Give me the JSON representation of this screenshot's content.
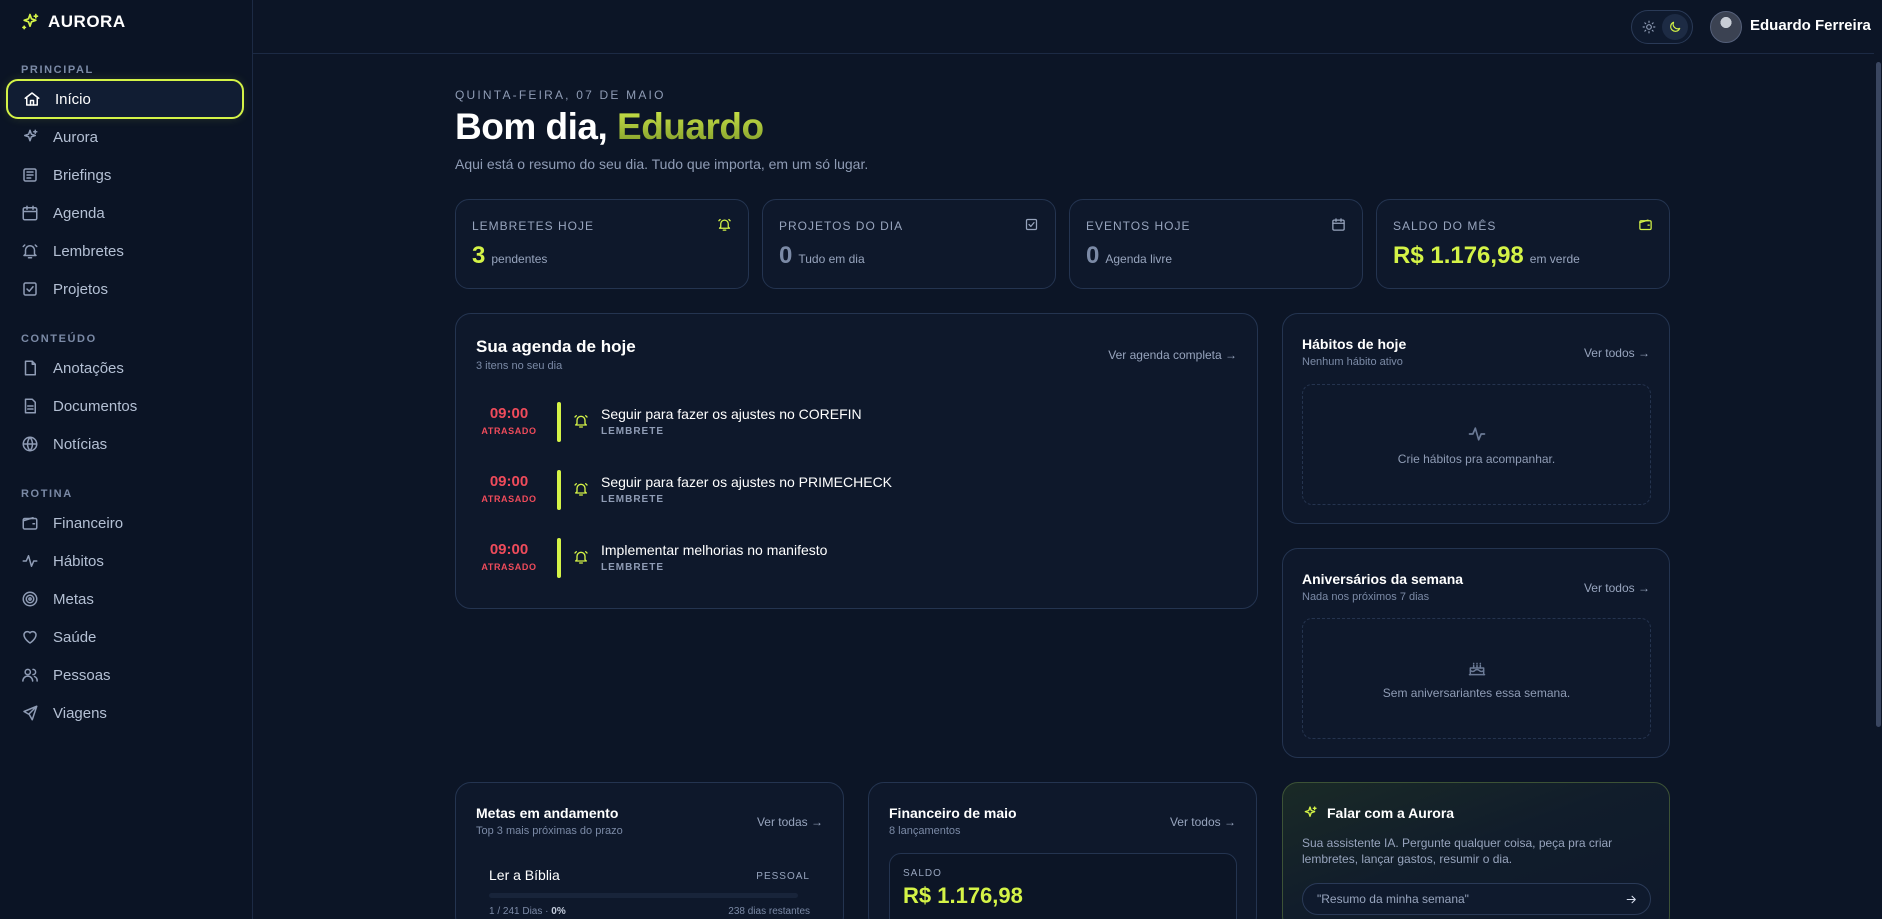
{
  "app": {
    "name": "AURORA"
  },
  "user": {
    "name": "Eduardo Ferreira"
  },
  "sidebar": {
    "sections": [
      {
        "label": "PRINCIPAL",
        "items": [
          {
            "label": "Início",
            "icon": "home-icon",
            "active": true
          },
          {
            "label": "Aurora",
            "icon": "sparkle-icon"
          },
          {
            "label": "Briefings",
            "icon": "newspaper-icon"
          },
          {
            "label": "Agenda",
            "icon": "calendar-icon"
          },
          {
            "label": "Lembretes",
            "icon": "bell-icon"
          },
          {
            "label": "Projetos",
            "icon": "checkbox-icon"
          }
        ]
      },
      {
        "label": "CONTEÚDO",
        "items": [
          {
            "label": "Anotações",
            "icon": "note-icon"
          },
          {
            "label": "Documentos",
            "icon": "document-icon"
          },
          {
            "label": "Notícias",
            "icon": "globe-icon"
          }
        ]
      },
      {
        "label": "ROTINA",
        "items": [
          {
            "label": "Financeiro",
            "icon": "wallet-icon"
          },
          {
            "label": "Hábitos",
            "icon": "activity-icon"
          },
          {
            "label": "Metas",
            "icon": "target-icon"
          },
          {
            "label": "Saúde",
            "icon": "heart-icon"
          },
          {
            "label": "Pessoas",
            "icon": "people-icon"
          },
          {
            "label": "Viagens",
            "icon": "plane-icon"
          }
        ]
      }
    ]
  },
  "header": {
    "date": "QUINTA-FEIRA, 07 DE MAIO",
    "greeting": "Bom dia,",
    "greeting_name": "Eduardo",
    "subtitle": "Aqui está o resumo do seu dia. Tudo que importa, em um só lugar."
  },
  "stats": [
    {
      "label": "LEMBRETES HOJE",
      "value": "3",
      "unit": "pendentes",
      "icon": "bell-icon",
      "accent": true
    },
    {
      "label": "PROJETOS DO DIA",
      "value": "0",
      "unit": "Tudo em dia",
      "icon": "checkbox-icon",
      "accent": false
    },
    {
      "label": "EVENTOS HOJE",
      "value": "0",
      "unit": "Agenda livre",
      "icon": "calendar-icon",
      "accent": false
    },
    {
      "label": "SALDO DO MÊS",
      "value": "R$ 1.176,98",
      "unit": "em verde",
      "icon": "wallet-icon",
      "accent": true
    }
  ],
  "agenda": {
    "title": "Sua agenda de hoje",
    "subtitle": "3 itens no seu dia",
    "link": "Ver agenda completa →",
    "items": [
      {
        "time": "09:00",
        "status": "ATRASADO",
        "title": "Seguir para fazer os ajustes no COREFIN",
        "type": "LEMBRETE"
      },
      {
        "time": "09:00",
        "status": "ATRASADO",
        "title": "Seguir para fazer os ajustes no PRIMECHECK",
        "type": "LEMBRETE"
      },
      {
        "time": "09:00",
        "status": "ATRASADO",
        "title": "Implementar melhorias no manifesto",
        "type": "LEMBRETE"
      }
    ]
  },
  "habits": {
    "title": "Hábitos de hoje",
    "subtitle": "Nenhum hábito ativo",
    "link": "Ver todos →",
    "empty": "Crie hábitos pra acompanhar."
  },
  "birthdays": {
    "title": "Aniversários da semana",
    "subtitle": "Nada nos próximos 7 dias",
    "link": "Ver todos →",
    "empty": "Sem aniversariantes essa semana."
  },
  "goals": {
    "title": "Metas em andamento",
    "subtitle": "Top 3 mais próximas do prazo",
    "link": "Ver todas →",
    "items": [
      {
        "name": "Ler a Bíblia",
        "tag": "PESSOAL",
        "progress_text": "1 / 241 Dias · ",
        "percent": "0%",
        "remaining": "238 dias restantes",
        "progress": 0
      }
    ]
  },
  "finance": {
    "title": "Financeiro de maio",
    "subtitle": "8 lançamentos",
    "link": "Ver todos →",
    "balance_label": "SALDO",
    "balance": "R$ 1.176,98"
  },
  "assistant": {
    "title": "Falar com a Aurora",
    "description": "Sua assistente IA. Pergunte qualquer coisa, peça pra criar lembretes, lançar gastos, resumir o dia.",
    "placeholder": "\"Resumo da minha semana\""
  },
  "colors": {
    "accent": "#d4f347",
    "danger": "#ef4b5b",
    "background": "#0c1526",
    "card": "#0e182b",
    "border": "#243450"
  }
}
